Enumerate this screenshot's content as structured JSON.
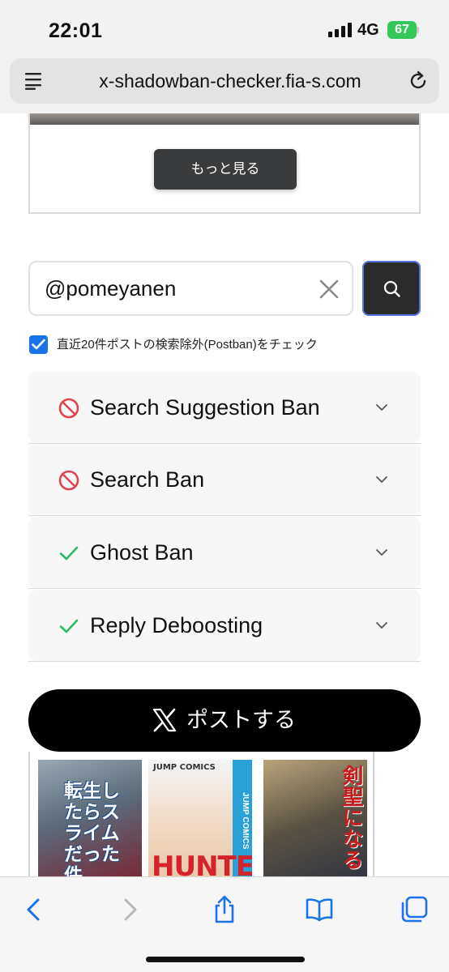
{
  "status_bar": {
    "time": "22:01",
    "network": "4G",
    "battery": "67"
  },
  "browser": {
    "url": "x-shadowban-checker.fia-s.com"
  },
  "main": {
    "more_button_label": "もっと見る",
    "search": {
      "prefix": "@",
      "value": "pomeyanen"
    },
    "postban_checkbox": {
      "checked": true,
      "label": "直近20件ポストの検索除外(Postban)をチェック"
    },
    "checks": [
      {
        "label": "Search Suggestion Ban",
        "status": "banned",
        "icon": "prohibited-icon",
        "color": "#e0454f"
      },
      {
        "label": "Search Ban",
        "status": "banned",
        "icon": "prohibited-icon",
        "color": "#e0454f"
      },
      {
        "label": "Ghost Ban",
        "status": "ok",
        "icon": "check-icon",
        "color": "#2fb866"
      },
      {
        "label": "Reply Deboosting",
        "status": "ok",
        "icon": "check-icon",
        "color": "#2fb866"
      }
    ],
    "post_button_label": "ポストする",
    "ad_covers": [
      {
        "title": "転生したらスライムだった件"
      },
      {
        "top_text": "JUMP COMICS",
        "title": "HUNTER",
        "band_text": "JUMP COMICS"
      },
      {
        "title": "剣聖になる"
      }
    ]
  },
  "toolbar": {
    "items": [
      "back-icon",
      "forward-icon",
      "share-icon",
      "bookmarks-icon",
      "tabs-icon"
    ],
    "accent": "#1a73e8"
  }
}
